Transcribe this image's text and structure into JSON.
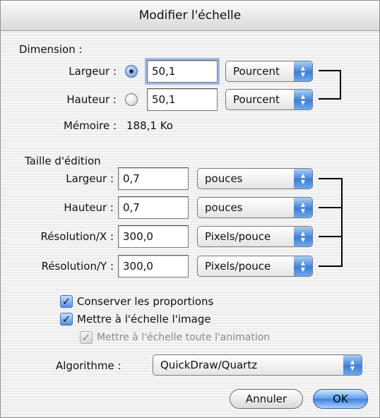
{
  "dialog": {
    "title": "Modifier l'échelle"
  },
  "dimension": {
    "section_label": "Dimension :",
    "width_label": "Largeur :",
    "width_value": "50,1",
    "width_unit": "Pourcent",
    "height_label": "Hauteur :",
    "height_value": "50,1",
    "height_unit": "Pourcent",
    "selected_radio": "width",
    "memory_label": "Mémoire :",
    "memory_value": "188,1 Ko"
  },
  "print_size": {
    "section_label": "Taille d'édition",
    "rows": [
      {
        "label": "Largeur :",
        "value": "0,7",
        "unit": "pouces"
      },
      {
        "label": "Hauteur :",
        "value": "0,7",
        "unit": "pouces"
      },
      {
        "label": "Résolution/X :",
        "value": "300,0",
        "unit": "Pixels/pouce"
      },
      {
        "label": "Résolution/Y :",
        "value": "300,0",
        "unit": "Pixels/pouce"
      }
    ]
  },
  "options": {
    "keep_proportions": {
      "label": "Conserver les proportions",
      "checked": true
    },
    "scale_image": {
      "label": "Mettre à l'échelle l'image",
      "checked": true
    },
    "scale_animation": {
      "label": "Mettre à l'échelle toute l'animation",
      "checked": true,
      "disabled": true
    }
  },
  "algorithm": {
    "label": "Algorithme :",
    "value": "QuickDraw/Quartz"
  },
  "buttons": {
    "cancel": "Annuler",
    "ok": "OK"
  },
  "colors": {
    "accent": "#3d7fd8",
    "focus_ring": "#9dbbe6"
  },
  "icons": {
    "radio": "radio-button",
    "check": "checkbox",
    "popup": "popup-arrows"
  }
}
